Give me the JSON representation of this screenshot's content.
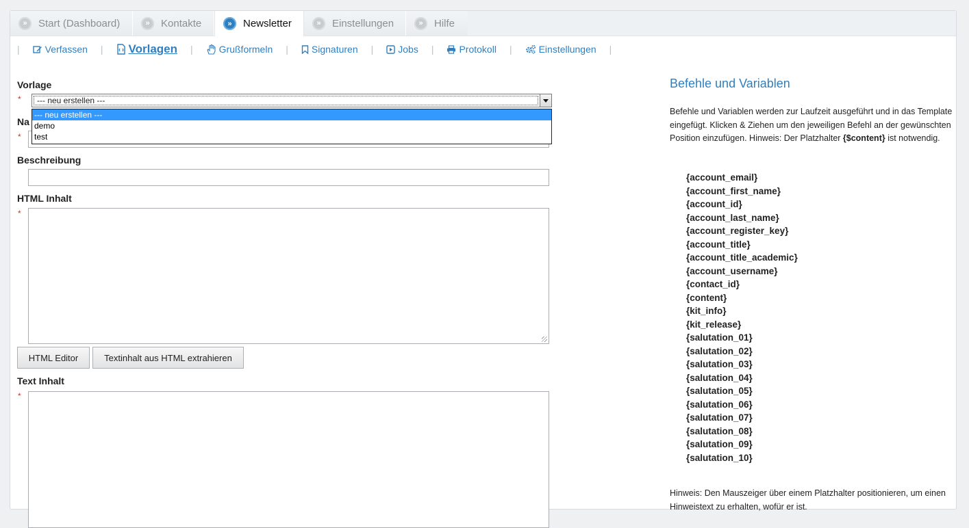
{
  "tabs": [
    {
      "label": "Start (Dashboard)",
      "active": false
    },
    {
      "label": "Kontakte",
      "active": false
    },
    {
      "label": "Newsletter",
      "active": true
    },
    {
      "label": "Einstellungen",
      "active": false
    },
    {
      "label": "Hilfe",
      "active": false
    }
  ],
  "tab_bullet": "»",
  "subnav": {
    "separator": "|",
    "items": [
      {
        "label": "Verfassen",
        "icon": "edit-icon"
      },
      {
        "label": "Vorlagen",
        "icon": "template-icon",
        "active": true
      },
      {
        "label": "Grußformeln",
        "icon": "hand-icon"
      },
      {
        "label": "Signaturen",
        "icon": "bookmark-icon"
      },
      {
        "label": "Jobs",
        "icon": "play-icon"
      },
      {
        "label": "Protokoll",
        "icon": "print-icon"
      },
      {
        "label": "Einstellungen",
        "icon": "gears-icon"
      }
    ]
  },
  "form": {
    "vorlage_label": "Vorlage",
    "vorlage_value": "--- neu erstellen ---",
    "vorlage_options": [
      "--- neu erstellen ---",
      "demo",
      "test"
    ],
    "name_label_partial": "Na",
    "beschreibung_label": "Beschreibung",
    "html_label": "HTML Inhalt",
    "text_label": "Text Inhalt",
    "required_mark": "*",
    "html_editor_button": "HTML Editor",
    "extract_button": "Textinhalt aus HTML extrahieren"
  },
  "sidebar": {
    "title": "Befehle und Variablen",
    "description_pre": "Befehle und Variablen werden zur Laufzeit ausgeführt und in das Template eingefügt. Klicken & Ziehen um den jeweiligen Befehl an der gewünschten Position einzufügen. Hinweis: Der Platzhalter ",
    "description_bold": "{$content}",
    "description_post": " ist notwendig.",
    "variables": [
      "{account_email}",
      "{account_first_name}",
      "{account_id}",
      "{account_last_name}",
      "{account_register_key}",
      "{account_title}",
      "{account_title_academic}",
      "{account_username}",
      "{contact_id}",
      "{content}",
      "{kit_info}",
      "{kit_release}",
      "{salutation_01}",
      "{salutation_02}",
      "{salutation_03}",
      "{salutation_04}",
      "{salutation_05}",
      "{salutation_06}",
      "{salutation_07}",
      "{salutation_08}",
      "{salutation_09}",
      "{salutation_10}"
    ],
    "hint": "Hinweis: Den Mauszeiger über einem Platzhalter positionieren, um einen Hinweistext zu erhalten, wofür er ist."
  },
  "colors": {
    "accent": "#2f7fc0",
    "selection": "#3399ff",
    "required": "#c0392b"
  }
}
